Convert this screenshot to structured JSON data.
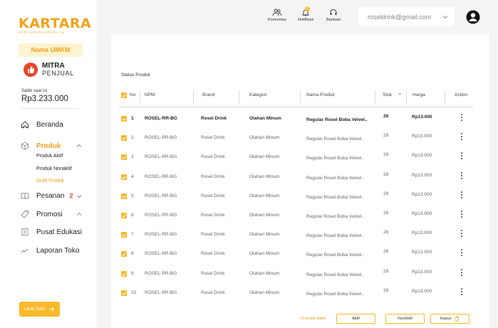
{
  "brand": {
    "name": "KARTARA",
    "tagline": "KARYANUSANTARA.ID"
  },
  "sidebar": {
    "umkm_label": "Nama UMKM",
    "mitra_line1": "MITRA",
    "mitra_line2": "PENJUAL",
    "saldo_label": "Saldo saat ini",
    "saldo_value": "Rp3.233.000",
    "nav": {
      "beranda": "Beranda",
      "produk": "Produk",
      "produk_aktif": "Produk Aktif",
      "produk_nonaktif": "Produk Nonaktif",
      "draft_produk": "Draft Produk",
      "pesanan": "Pesanan",
      "pesanan_count": "2",
      "promosi": "Promosi",
      "pusat_edukasi": "Pusat Edukasi",
      "laporan_toko": "Laporan Toko"
    },
    "lihat_toko": "Lihat Toko"
  },
  "topbar": {
    "komunitas": "Komunitas",
    "notifikasi": "Notifikasi",
    "notif_count": "3",
    "bantuan": "Bantuan",
    "email": "roseldrink@gmail.com"
  },
  "main": {
    "section_title": "Status Produk",
    "columns": {
      "no": "No",
      "npm": "NPM",
      "brand": "Brand",
      "kategori": "Kategori",
      "nama": "Nama Produk",
      "stok": "Stok",
      "harga": "Harga",
      "action": "Action"
    },
    "rows": [
      {
        "no": "1",
        "npm": "ROSEL-RR-BG",
        "brand": "Rosel Drink",
        "kategori": "Olahan Minum",
        "nama": "Regular Rosel Boba Velvel..",
        "stok": "28",
        "harga": "Rp13.000"
      },
      {
        "no": "2",
        "npm": "ROSEL-RR-BG",
        "brand": "Rosel Drink",
        "kategori": "Olahan Minum",
        "nama": "Regular Rosel Boba Velvel..",
        "stok": "28",
        "harga": "Rp13.000"
      },
      {
        "no": "3",
        "npm": "ROSEL-RR-BG",
        "brand": "Rosel Drink",
        "kategori": "Olahan Minum",
        "nama": "Regular Rosel Boba Velvel..",
        "stok": "28",
        "harga": "Rp13.000"
      },
      {
        "no": "4",
        "npm": "ROSEL-RR-BG",
        "brand": "Rosel Drink",
        "kategori": "Olahan Minum",
        "nama": "Regular Rosel Boba Velvel..",
        "stok": "28",
        "harga": "Rp13.000"
      },
      {
        "no": "5",
        "npm": "ROSEL-RR-BG",
        "brand": "Rosel Drink",
        "kategori": "Olahan Minum",
        "nama": "Regular Rosel Boba Velvel..",
        "stok": "28",
        "harga": "Rp13.000"
      },
      {
        "no": "6",
        "npm": "ROSEL-RR-BG",
        "brand": "Rosel Drink",
        "kategori": "Olahan Minum",
        "nama": "Regular Rosel Boba Velvel..",
        "stok": "28",
        "harga": "Rp13.000"
      },
      {
        "no": "7",
        "npm": "ROSEL-RR-BG",
        "brand": "Rosel Drink",
        "kategori": "Olahan Minum",
        "nama": "Regular Rosel Boba Velvel..",
        "stok": "28",
        "harga": "Rp13.000"
      },
      {
        "no": "8",
        "npm": "ROSEL-RR-BG",
        "brand": "Rosel Drink",
        "kategori": "Olahan Minum",
        "nama": "Regular Rosel Boba Velvel..",
        "stok": "28",
        "harga": "Rp13.000"
      },
      {
        "no": "9",
        "npm": "ROSEL-RR-BG",
        "brand": "Rosel Drink",
        "kategori": "Olahan Minum",
        "nama": "Regular Rosel Boba Velvel..",
        "stok": "28",
        "harga": "Rp13.000"
      },
      {
        "no": "10",
        "npm": "ROSEL-RR-BG",
        "brand": "Rosel Drink",
        "kategori": "Olahan Minum",
        "nama": "Regular Rosel Boba Velvel..",
        "stok": "28",
        "harga": "Rp13.000"
      }
    ],
    "footer": {
      "selected_text": "10 produk dipilih",
      "aktif_label": "Aktif",
      "nonaktif_label": "NonAktif",
      "hapus_label": "Hapus"
    }
  },
  "colors": {
    "accent": "#f9b92b",
    "brand": "#f3a21b",
    "danger": "#e8452c",
    "background": "#f4f4f5"
  },
  "icons": [
    "home-icon",
    "box-icon",
    "book-icon",
    "tag-icon",
    "edu-icon",
    "chart-icon",
    "community-icon",
    "bell-icon",
    "headset-icon",
    "user-icon",
    "chevron-down-icon",
    "chevron-up-icon",
    "check-icon",
    "kebab-icon",
    "trash-icon",
    "arrow-right-icon",
    "sort-icon"
  ]
}
